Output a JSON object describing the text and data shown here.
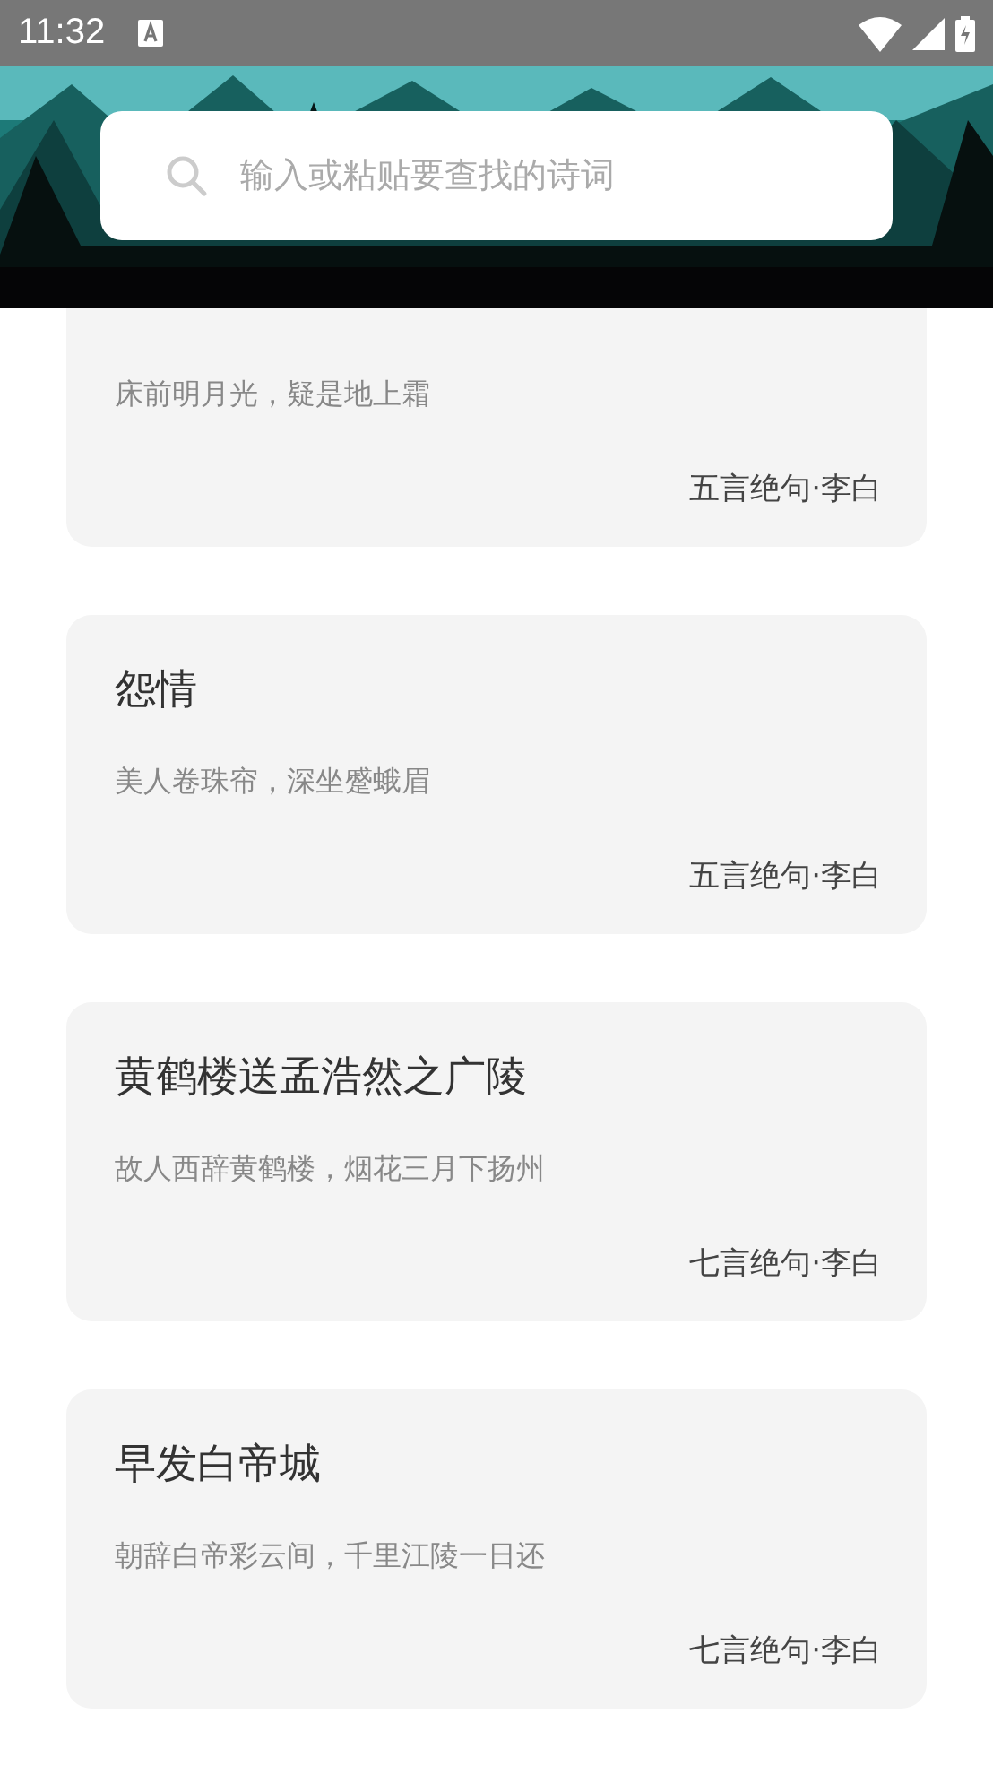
{
  "status_bar": {
    "time": "11:32"
  },
  "search": {
    "placeholder": "输入或粘贴要查找的诗词"
  },
  "poems": [
    {
      "line": "床前明月光，疑是地上霜",
      "meta": "五言绝句·李白"
    },
    {
      "title": "怨情",
      "line": "美人卷珠帘，深坐蹙蛾眉",
      "meta": "五言绝句·李白"
    },
    {
      "title": "黄鹤楼送孟浩然之广陵",
      "line": "故人西辞黄鹤楼，烟花三月下扬州",
      "meta": "七言绝句·李白"
    },
    {
      "title": "早发白帝城",
      "line": "朝辞白帝彩云间，千里江陵一日还",
      "meta": "七言绝句·李白"
    }
  ]
}
